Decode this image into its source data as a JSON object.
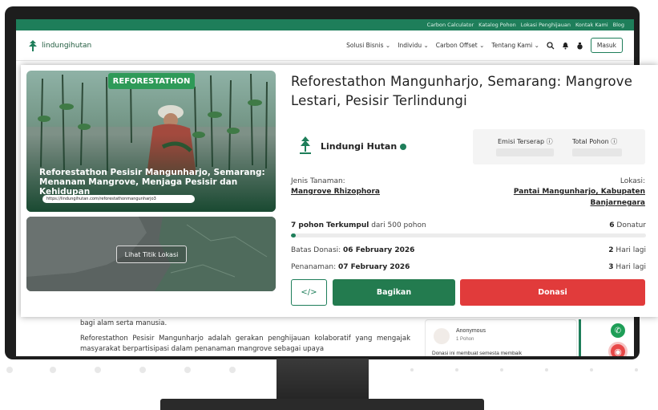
{
  "topbar": {
    "links": [
      "Carbon Calculator",
      "Katalog Pohon",
      "Lokasi Penghijauan",
      "Kontak Kami",
      "Blog"
    ]
  },
  "nav": {
    "brand": "lindungihutan",
    "links": [
      "Solusi Bisnis ⌄",
      "Individu ⌄",
      "Carbon Offset ⌄",
      "Tentang Kami ⌄"
    ],
    "login": "Masuk"
  },
  "hero": {
    "badge": "REFORESTATHON",
    "headline": "Reforestathon Pesisir Mangunharjo, Semarang: Menanam Mangrove, Menjaga Pesisir dan Kehidupan",
    "url": "https://lindungihutan.com/reforestathonmangunharjo3"
  },
  "map": {
    "button": "Lihat Titik Lokasi"
  },
  "campaign": {
    "title": "Reforestathon Mangunharjo, Semarang: Mangrove Lestari, Pesisir Terlindungi",
    "org": "Lindungi Hutan",
    "stats": {
      "emisi_label": "Emisi Terserap",
      "pohon_label": "Total Pohon"
    },
    "jenis_label": "Jenis Tanaman:",
    "jenis_value": "Mangrove Rhizophora",
    "lokasi_label": "Lokasi:",
    "lokasi_value_1": "Pantai Mangunharjo, Kabupaten",
    "lokasi_value_2": "Banjarnegara",
    "collected_bold": "7 pohon Terkumpul",
    "collected_rest": " dari 500 pohon",
    "donatur_count": "6",
    "donatur_label": " Donatur",
    "progress": 0.014,
    "batas_label": "Batas Donasi: ",
    "batas_date": "06 February 2026",
    "batas_remaining_num": "2",
    "batas_remaining": " Hari lagi",
    "tanam_label": "Penanaman: ",
    "tanam_date": "07 February 2026",
    "tanam_remaining_num": "3",
    "tanam_remaining": " Hari lagi"
  },
  "buttons": {
    "embed": "</>",
    "share": "Bagikan",
    "donate": "Donasi"
  },
  "body": {
    "p1": "bagi alam serta manusia.",
    "p2": "Reforestathon Pesisir Mangunharjo adalah gerakan penghijauan kolaboratif yang mengajak masyarakat berpartisipasi dalam penanaman mangrove sebagai upaya"
  },
  "donor": {
    "name": "Anonymous",
    "sub": "1 Pohon",
    "msg": "Donasi ini membuat semesta membaik"
  },
  "colors": {
    "brand": "#1e7e5a",
    "donate": "#e13b3b"
  }
}
